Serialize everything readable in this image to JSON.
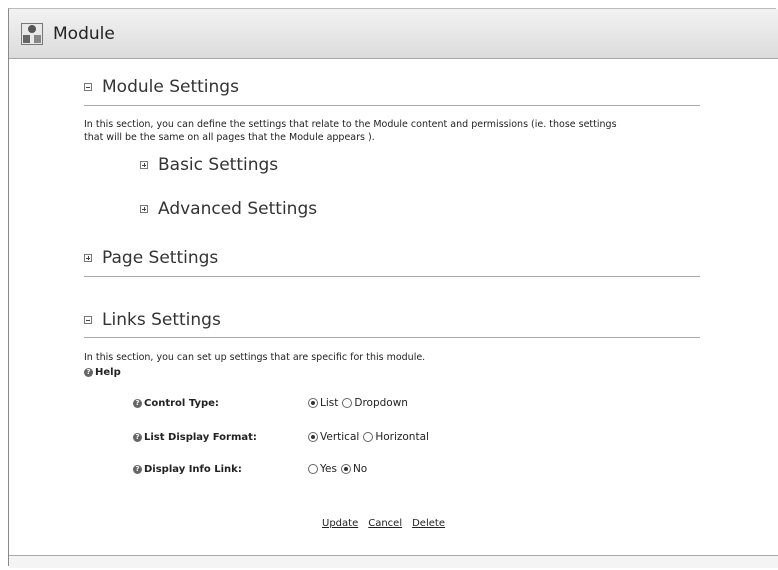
{
  "window": {
    "title": "Module",
    "icon": "module-icon"
  },
  "module_settings": {
    "label": "Module Settings",
    "description_line1": "In this section, you can define the settings that relate to the Module content and permissions (ie. those settings",
    "description_line2": "that will be the same on all pages that the Module appears ).",
    "basic_label": "Basic Settings",
    "advanced_label": "Advanced Settings"
  },
  "page_settings": {
    "label": "Page Settings"
  },
  "links_settings": {
    "label": "Links Settings",
    "description": "In this section, you can set up settings that are specific for this module.",
    "help_label": "Help",
    "control_type": {
      "label": "Control Type:",
      "opt1": "List",
      "opt2": "Dropdown",
      "selected": "List"
    },
    "list_display_format": {
      "label": "List Display Format:",
      "opt1": "Vertical",
      "opt2": "Horizontal",
      "selected": "Vertical"
    },
    "display_info_link": {
      "label": "Display Info Link:",
      "opt1": "Yes",
      "opt2": "No",
      "selected": "No"
    }
  },
  "actions": {
    "update": "Update",
    "cancel": "Cancel",
    "delete": "Delete"
  }
}
